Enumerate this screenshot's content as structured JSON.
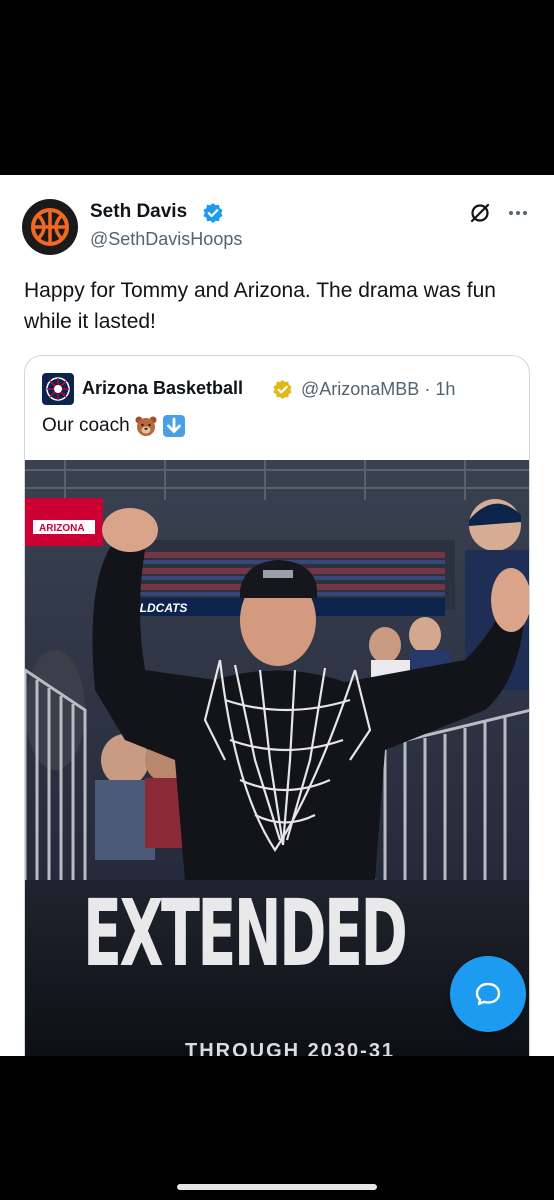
{
  "tweet": {
    "author_name": "Seth Davis",
    "author_handle": "@SethDavisHoops",
    "text": "Happy for Tommy and Arizona. The drama was fun while it lasted!",
    "avatar_icon": "basketball-icon",
    "verified_icon": "verified-badge-icon",
    "grok_icon": "grok-icon",
    "more_icon": "more-options-icon"
  },
  "quote": {
    "author_name": "Arizona Basketball",
    "author_handle": "@ArizonaMBB",
    "separator": "·",
    "time": "1h",
    "text": "Our coach",
    "emojis": [
      "bear-face-emoji",
      "down-arrow-emoji"
    ],
    "verified_icon": "gold-verified-badge-icon",
    "image": {
      "logo_text": "ARIZONA",
      "banner_text": "WILDCATS",
      "headline": "EXTENDED",
      "subline": "THROUGH 2030-31"
    }
  },
  "colors": {
    "accent": "#1d9bf0",
    "verified_blue": "#1d9bf0",
    "verified_gold": "#e2b719",
    "arizona_red": "#cc0033",
    "arizona_navy": "#0c234b",
    "text_primary": "#0f1419",
    "text_secondary": "#536471"
  },
  "fab": {
    "icon": "reply-bubble-icon"
  }
}
